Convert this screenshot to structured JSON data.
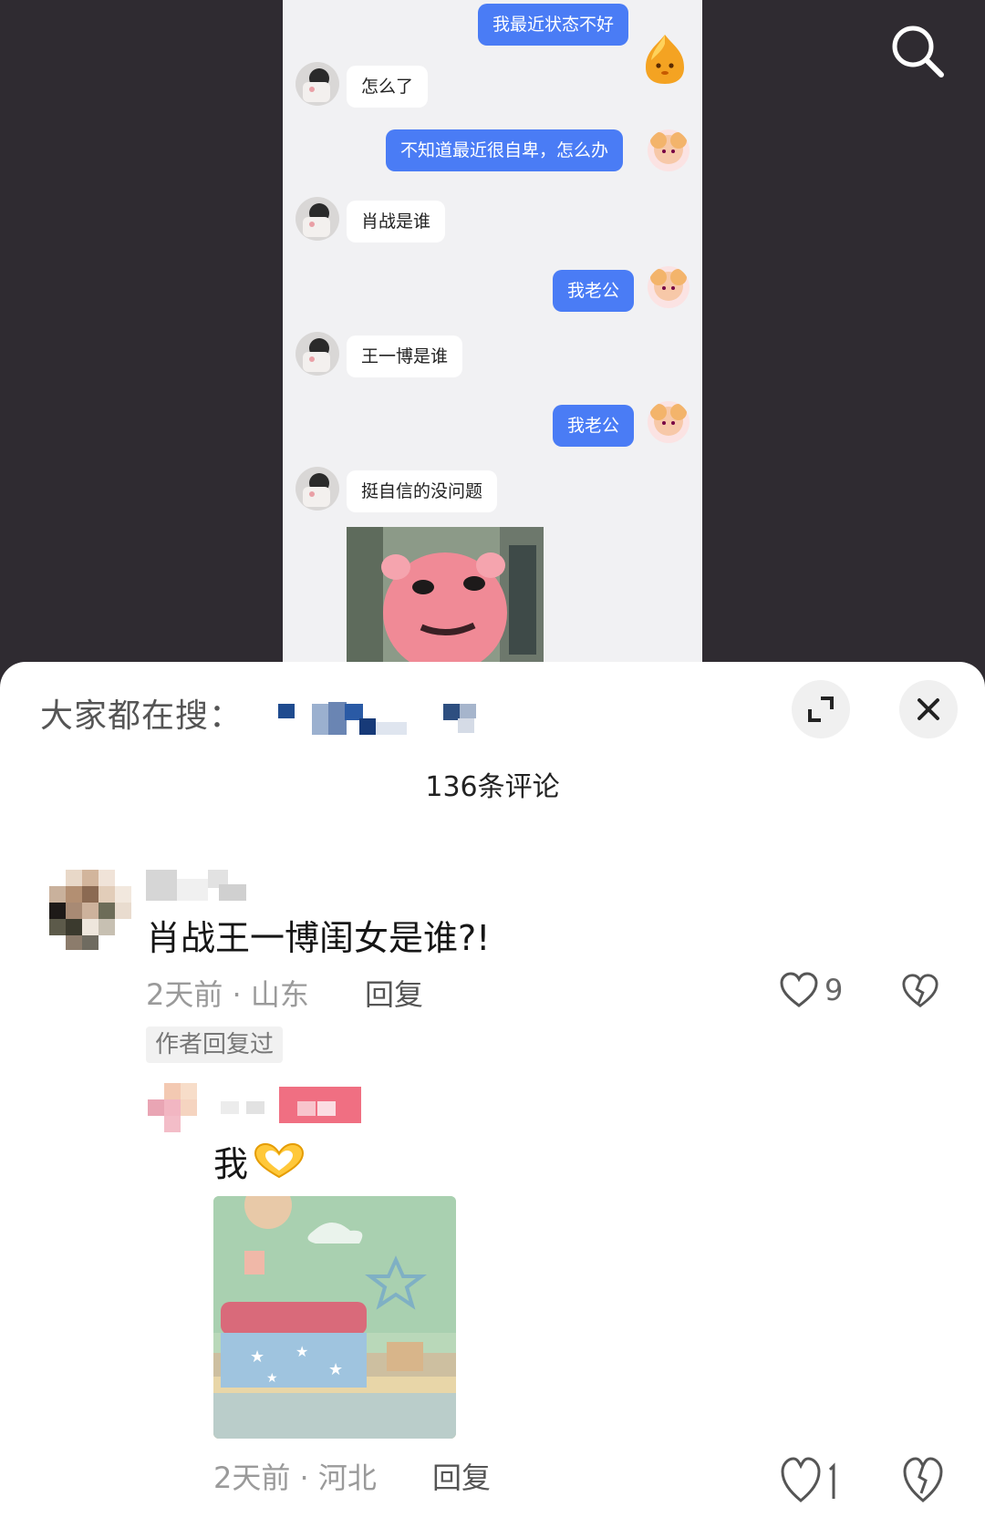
{
  "icons": {
    "search": "search-icon",
    "expand": "expand-icon",
    "close": "close-icon",
    "like": "heart-icon",
    "dislike": "broken-heart-icon",
    "emoji": "heart-hands-emoji"
  },
  "colors": {
    "sent_bubble": "#4a7cf5",
    "received_bubble": "#ffffff",
    "chat_background": "#f1f1f3",
    "video_background": "#2f2b31"
  },
  "chat": {
    "messages": [
      {
        "side": "right",
        "text": "我最近状态不好"
      },
      {
        "side": "left",
        "text": "怎么了"
      },
      {
        "side": "right",
        "text": "不知道最近很自卑，怎么办"
      },
      {
        "side": "left",
        "text": "肖战是谁"
      },
      {
        "side": "right",
        "text": "我老公"
      },
      {
        "side": "left",
        "text": "王一博是谁"
      },
      {
        "side": "right",
        "text": "我老公"
      },
      {
        "side": "left",
        "text": "挺自信的没问题"
      }
    ]
  },
  "sheet": {
    "hot_search_label": "大家都在搜：",
    "comment_count": "136条评论"
  },
  "comment": {
    "text": "肖战王一博闺女是谁?!",
    "meta": "2天前 · 山东",
    "reply_label": "回复",
    "likes": "9",
    "author_tag": "作者回复过"
  },
  "reply": {
    "text": "我",
    "meta": "2天前 · 河北",
    "reply_label": "回复"
  }
}
